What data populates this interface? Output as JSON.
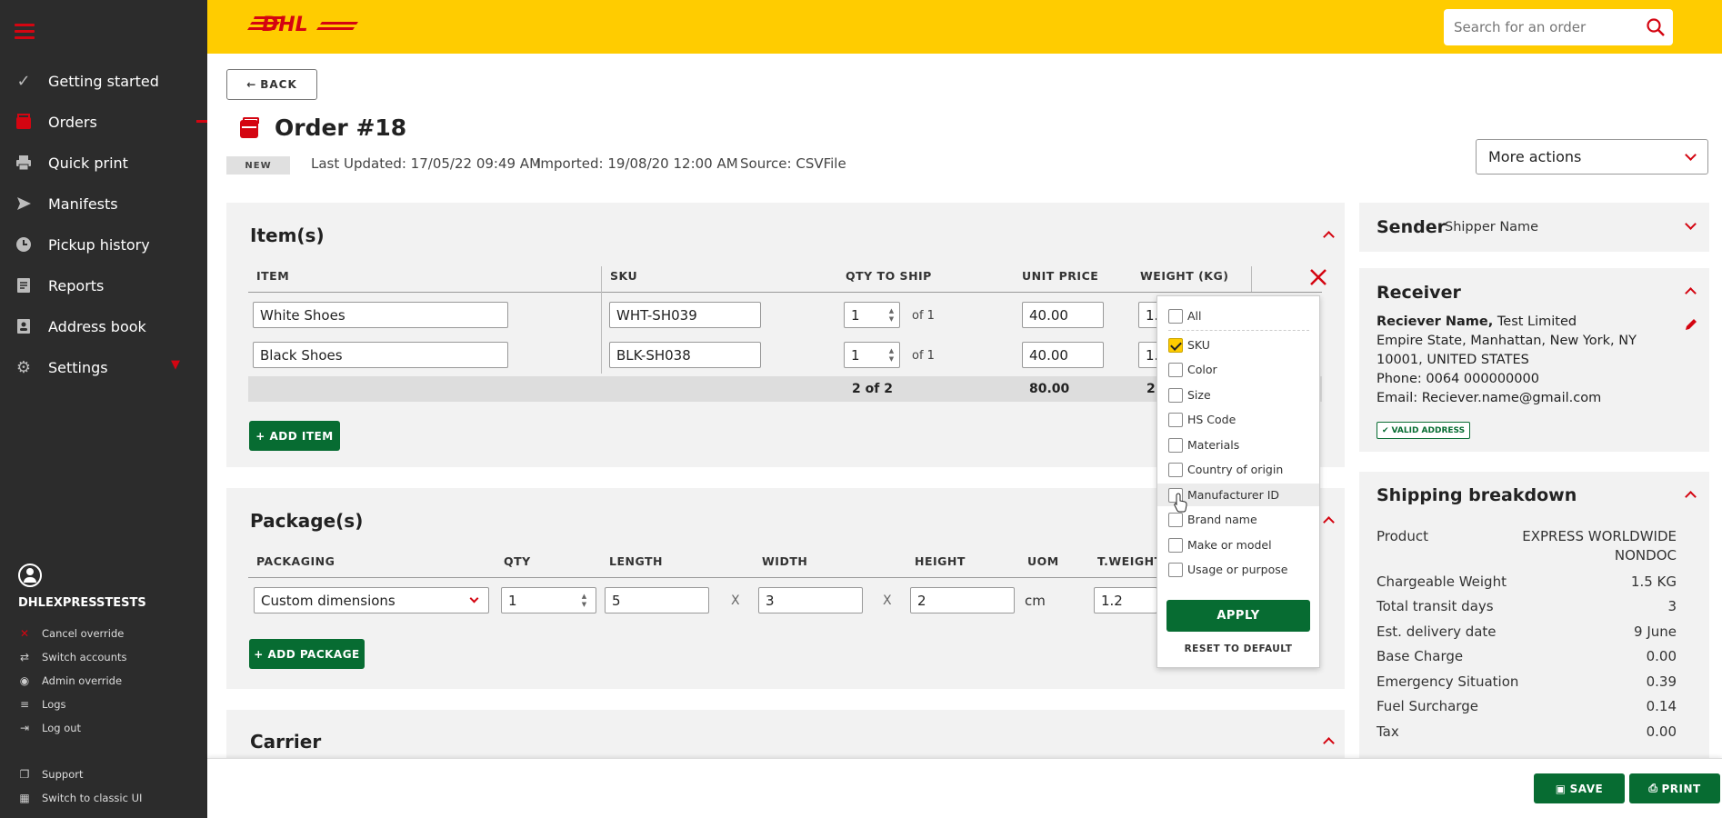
{
  "sidebar": {
    "items": [
      {
        "label": "Getting started",
        "icon": "check-icon"
      },
      {
        "label": "Orders",
        "icon": "orders-box-icon"
      },
      {
        "label": "Quick print",
        "icon": "printer-icon"
      },
      {
        "label": "Manifests",
        "icon": "send-icon"
      },
      {
        "label": "Pickup history",
        "icon": "clock-icon"
      },
      {
        "label": "Reports",
        "icon": "report-icon"
      },
      {
        "label": "Address book",
        "icon": "address-book-icon"
      },
      {
        "label": "Settings",
        "icon": "gear-icon"
      }
    ],
    "user": "DHLEXPRESSTESTS",
    "user_links": [
      {
        "label": "Cancel override",
        "icon": "close-icon"
      },
      {
        "label": "Switch accounts",
        "icon": "switch-icon"
      },
      {
        "label": "Admin override",
        "icon": "eye-icon"
      },
      {
        "label": "Logs",
        "icon": "list-icon"
      },
      {
        "label": "Log out",
        "icon": "logout-icon"
      }
    ],
    "footer_links": [
      {
        "label": "Support",
        "icon": "support-icon"
      },
      {
        "label": "Switch to classic UI",
        "icon": "grid-icon"
      }
    ]
  },
  "header": {
    "brand": "DHL",
    "search_placeholder": "Search for an order"
  },
  "order": {
    "back_label": "BACK",
    "title": "Order #18",
    "status": "NEW",
    "last_updated": "Last Updated: 17/05/22 09:49 AM",
    "imported": "Imported: 19/08/20 12:00 AM",
    "source": "Source: CSVFile",
    "more_actions": "More actions"
  },
  "items_panel": {
    "title": "Item(s)",
    "columns": [
      "ITEM",
      "SKU",
      "QTY TO SHIP",
      "UNIT PRICE",
      "WEIGHT (KG)"
    ],
    "rows": [
      {
        "item": "White Shoes",
        "sku": "WHT-SH039",
        "qty": "1",
        "of": "of 1",
        "price": "40.00",
        "weight": "1."
      },
      {
        "item": "Black Shoes",
        "sku": "BLK-SH038",
        "qty": "1",
        "of": "of 1",
        "price": "40.00",
        "weight": "1."
      }
    ],
    "total_qty": "2 of 2",
    "total_price": "80.00",
    "total_weight": "2.",
    "add_label": "+ ADD ITEM"
  },
  "column_menu": {
    "options": [
      {
        "label": "All",
        "checked": false
      },
      {
        "label": "SKU",
        "checked": true
      },
      {
        "label": "Color",
        "checked": false
      },
      {
        "label": "Size",
        "checked": false
      },
      {
        "label": "HS Code",
        "checked": false
      },
      {
        "label": "Materials",
        "checked": false
      },
      {
        "label": "Country of origin",
        "checked": false
      },
      {
        "label": "Manufacturer ID",
        "checked": false
      },
      {
        "label": "Brand name",
        "checked": false
      },
      {
        "label": "Make or model",
        "checked": false
      },
      {
        "label": "Usage or purpose",
        "checked": false
      }
    ],
    "apply": "APPLY",
    "reset": "RESET TO DEFAULT"
  },
  "packages_panel": {
    "title": "Package(s)",
    "columns": [
      "PACKAGING",
      "QTY",
      "LENGTH",
      "WIDTH",
      "HEIGHT",
      "UOM",
      "T.WEIGHT"
    ],
    "row": {
      "packaging": "Custom dimensions",
      "qty": "1",
      "length": "5",
      "x1": "X",
      "width": "3",
      "x2": "X",
      "height": "2",
      "uom": "cm",
      "weight": "1.2"
    },
    "add_label": "+ ADD PACKAGE"
  },
  "carrier_panel": {
    "title": "Carrier"
  },
  "sender": {
    "title": "Sender",
    "name": "Shipper Name"
  },
  "receiver": {
    "title": "Receiver",
    "name_bold": "Reciever Name,",
    "company": " Test Limited",
    "line1": "Empire State, Manhattan, New York, NY",
    "line2": "10001, UNITED STATES",
    "phone": "Phone: 0064 000000000",
    "email": "Email: Reciever.name@gmail.com",
    "badge": "VALID ADDRESS"
  },
  "shipping": {
    "title": "Shipping breakdown",
    "rows": [
      {
        "label": "Product",
        "value": "EXPRESS WORLDWIDE",
        "value2": "NONDOC"
      },
      {
        "label": "Chargeable Weight",
        "value": "1.5 KG"
      },
      {
        "label": "Total transit days",
        "value": "3"
      },
      {
        "label": "Est. delivery date",
        "value": "9 June"
      },
      {
        "label": "Base Charge",
        "value": "0.00"
      },
      {
        "label": "Emergency Situation",
        "value": "0.39"
      },
      {
        "label": "Fuel Surcharge",
        "value": "0.14"
      },
      {
        "label": "Tax",
        "value": "0.00"
      }
    ]
  },
  "footer": {
    "save": "SAVE",
    "print": "PRINT"
  },
  "colors": {
    "brand_yellow": "#ffcc00",
    "brand_red": "#d40511",
    "action_green": "#076c32",
    "sidebar_bg": "#2c2c2c"
  }
}
